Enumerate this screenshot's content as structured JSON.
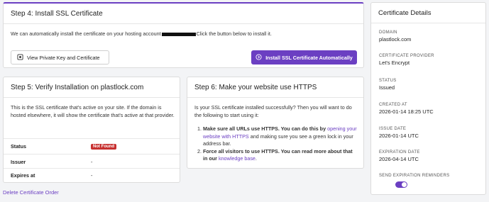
{
  "step4": {
    "title": "Step 4: Install SSL Certificate",
    "description_pre": "We can automatically install the certificate on your hosting account",
    "description_post": "Click the button below to install it.",
    "view_key_button": "View Private Key and Certificate",
    "install_button": "Install SSL Certificate Automatically"
  },
  "step5": {
    "title": "Step 5: Verify Installation on plastlock.com",
    "description": "This is the SSL certificate that's active on your site. If the domain is hosted elsewhere, it will show the certificate that's active at that provider.",
    "rows": [
      {
        "label": "Status",
        "value": "Not Found"
      },
      {
        "label": "Issuer",
        "value": "-"
      },
      {
        "label": "Expires at",
        "value": "-"
      }
    ]
  },
  "step6": {
    "title": "Step 6: Make your website use HTTPS",
    "intro": "Is your SSL certificate installed successfully? Then you will want to do the following to start using it:",
    "item1_bold": "Make sure all URLs use HTTPS. You can do this by",
    "item1_link": "opening your website with HTTPS",
    "item1_rest": "and making sure you see a green lock in your address bar.",
    "item2_bold": "Force all visitors to use HTTPS. You can read more about that in our",
    "item2_link": "knowledge base",
    "item2_end": "."
  },
  "delete_link": "Delete Certificate Order",
  "details": {
    "title": "Certificate Details",
    "fields": [
      {
        "label": "DOMAIN",
        "value": "plastlock.com"
      },
      {
        "label": "CERTIFICATE PROVIDER",
        "value": "Let's Encrypt"
      },
      {
        "label": "STATUS",
        "value": "Issued"
      },
      {
        "label": "CREATED AT",
        "value": "2026-01-14 18:25 UTC"
      },
      {
        "label": "ISSUE DATE",
        "value": "2026-01-14 UTC"
      },
      {
        "label": "EXPIRATION DATE",
        "value": "2026-04-14 UTC"
      }
    ],
    "reminders_label": "SEND EXPIRATION REMINDERS",
    "reminders_on": true
  },
  "colors": {
    "accent": "#6b3fc2",
    "danger": "#c7302f"
  }
}
